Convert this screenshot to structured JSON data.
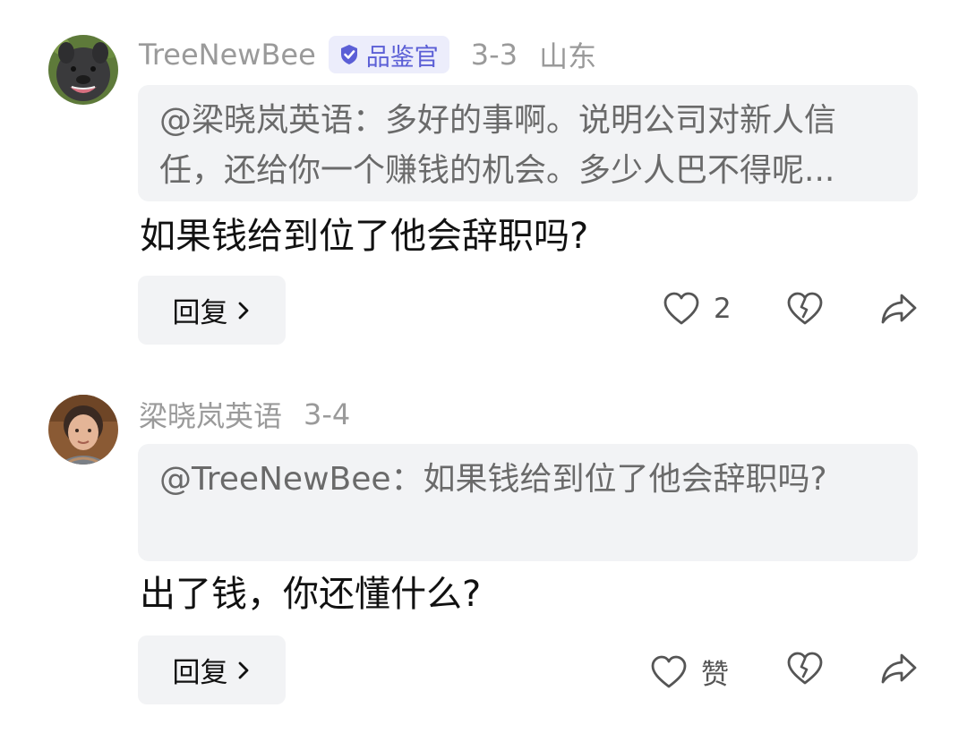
{
  "comments": [
    {
      "username": "TreeNewBee",
      "badge": "品鉴官",
      "date": "3-3",
      "location": "山东",
      "quote": "@梁晓岚英语：多好的事啊。说明公司对新人信任，还给你一个赚钱的机会。多少人巴不得呢...",
      "text": "如果钱给到位了他会辞职吗?",
      "reply_label": "回复",
      "like_count": "2",
      "avatar_icon": "dog-avatar"
    },
    {
      "username": "梁晓岚英语",
      "date": "3-4",
      "quote": "@TreeNewBee：如果钱给到位了他会辞职吗?",
      "text": "出了钱，你还懂什么?",
      "reply_label": "回复",
      "like_count": "赞",
      "avatar_icon": "woman-avatar"
    }
  ],
  "colors": {
    "badge_text": "#5b5fd6",
    "badge_bg": "#ecedfb",
    "meta_gray": "#9a9a9a",
    "quote_bg": "#f2f3f5"
  }
}
